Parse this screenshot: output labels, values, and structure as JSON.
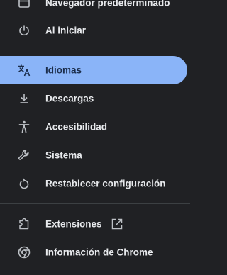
{
  "menu": {
    "items": [
      {
        "label": "Navegador predeterminado",
        "icon": "browser-icon"
      },
      {
        "label": "Al iniciar",
        "icon": "power-icon"
      },
      {
        "label": "Idiomas",
        "icon": "translate-icon",
        "selected": true
      },
      {
        "label": "Descargas",
        "icon": "download-icon"
      },
      {
        "label": "Accesibilidad",
        "icon": "accessibility-icon"
      },
      {
        "label": "Sistema",
        "icon": "wrench-icon"
      },
      {
        "label": "Restablecer configuración",
        "icon": "restore-icon"
      },
      {
        "label": "Extensiones",
        "icon": "puzzle-icon",
        "external_link_icon": "open-in-new-icon"
      },
      {
        "label": "Información de Chrome",
        "icon": "chrome-icon"
      }
    ]
  },
  "colors": {
    "background": "#202124",
    "selected_background": "#8ab4f8",
    "text": "#e8eaed",
    "selected_text": "#1b2d4a",
    "icon": "#bdc1c6",
    "divider": "#3c4043"
  }
}
